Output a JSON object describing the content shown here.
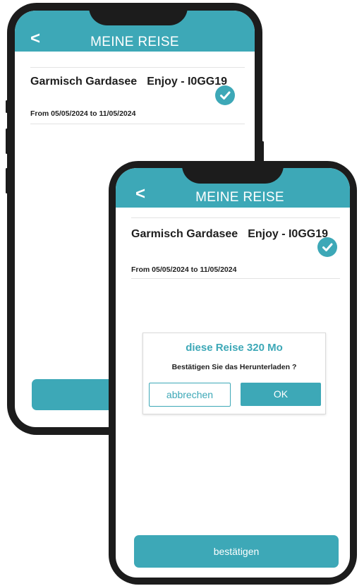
{
  "accent_color": "#3da8b7",
  "back_phone": {
    "header": {
      "back_icon": "chevron-left-icon",
      "title": "MEINE REISE"
    },
    "trip": {
      "name": "Garmisch Gardasee",
      "code": "Enjoy - I0GG19",
      "dates": "From 05/05/2024 to 11/05/2024",
      "status_icon": "check-circle-icon"
    }
  },
  "front_phone": {
    "header": {
      "back_icon": "chevron-left-icon",
      "title": "MEINE REISE"
    },
    "trip": {
      "name": "Garmisch Gardasee",
      "code": "Enjoy - I0GG19",
      "dates": "From 05/05/2024 to 11/05/2024",
      "status_icon": "check-circle-icon"
    },
    "dialog": {
      "title": "diese Reise 320 Mo",
      "message": "Bestätigen Sie das Herunterladen ?",
      "cancel_label": "abbrechen",
      "ok_label": "OK"
    },
    "confirm_label": "bestätigen"
  }
}
